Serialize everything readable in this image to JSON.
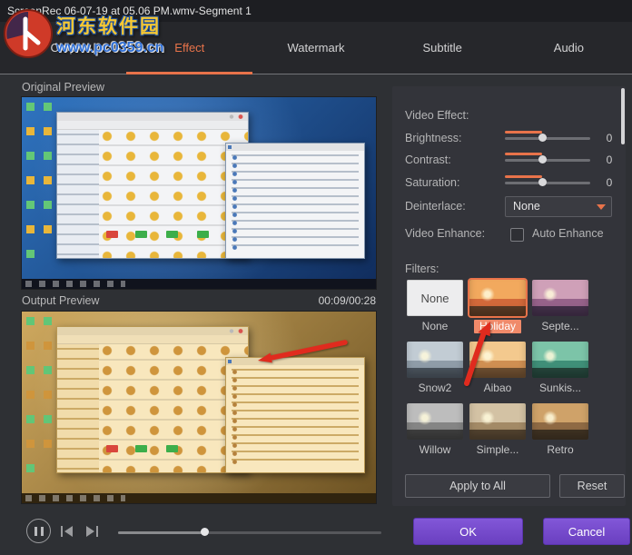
{
  "window": {
    "title": "ScreenRec 06-07-19 at 05.06 PM.wmv-Segment 1"
  },
  "watermark": {
    "site_name": "河东软件园",
    "site_url": "www.pc0359.cn"
  },
  "tabs": [
    {
      "label": "Crop",
      "active": false
    },
    {
      "label": "Effect",
      "active": true
    },
    {
      "label": "Watermark",
      "active": false
    },
    {
      "label": "Subtitle",
      "active": false
    },
    {
      "label": "Audio",
      "active": false
    }
  ],
  "previews": {
    "original_label": "Original Preview",
    "output_label": "Output Preview",
    "timecode": "00:09/00:28"
  },
  "effects": {
    "section_label": "Video Effect:",
    "sliders": [
      {
        "label": "Brightness:",
        "value": "0"
      },
      {
        "label": "Contrast:",
        "value": "0"
      },
      {
        "label": "Saturation:",
        "value": "0"
      }
    ],
    "deinterlace_label": "Deinterlace:",
    "deinterlace_value": "None",
    "enhance_label": "Video Enhance:",
    "enhance_option": "Auto Enhance"
  },
  "filters": {
    "section_label": "Filters:",
    "items": [
      {
        "name": "None",
        "selected": false
      },
      {
        "name": "Holiday",
        "selected": true
      },
      {
        "name": "Septe...",
        "selected": false
      },
      {
        "name": "Snow2",
        "selected": false
      },
      {
        "name": "Aibao",
        "selected": false
      },
      {
        "name": "Sunkis...",
        "selected": false
      },
      {
        "name": "Willow",
        "selected": false
      },
      {
        "name": "Simple...",
        "selected": false
      },
      {
        "name": "Retro",
        "selected": false
      }
    ]
  },
  "buttons": {
    "apply_to_all": "Apply to All",
    "reset": "Reset",
    "ok": "OK",
    "cancel": "Cancel"
  },
  "colors": {
    "accent_orange": "#e8734a",
    "selected_filter_label": "#f08a6a",
    "primary_purple": "#7a4fd6",
    "annotation_red": "#e02b1e"
  }
}
